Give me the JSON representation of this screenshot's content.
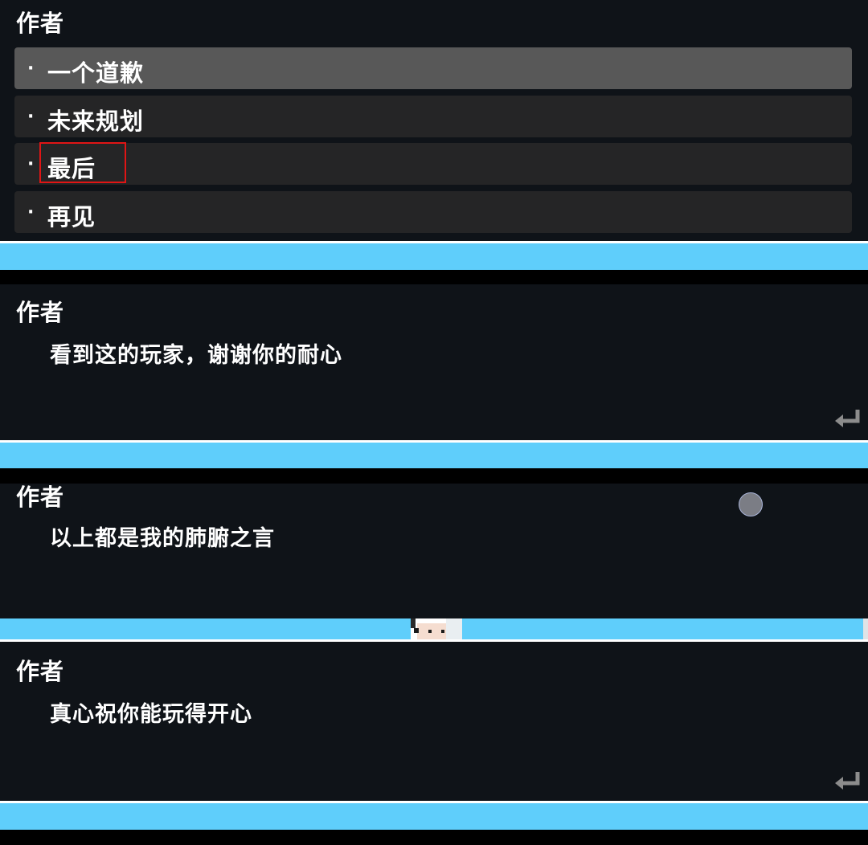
{
  "choice_menu": {
    "speaker": "作者",
    "options": [
      {
        "bullet": "·",
        "label": "一个道歉",
        "selected": true
      },
      {
        "bullet": "·",
        "label": "未来规划",
        "selected": false
      },
      {
        "bullet": "·",
        "label": "最后",
        "selected": false,
        "highlighted": true
      },
      {
        "bullet": "·",
        "label": "再见",
        "selected": false
      }
    ]
  },
  "dialogs": [
    {
      "speaker": "作者",
      "text": "看到这的玩家，谢谢你的耐心",
      "has_continue_icon": true
    },
    {
      "speaker": "作者",
      "text": "以上都是我的肺腑之言",
      "has_continue_icon": false
    },
    {
      "speaker": "作者",
      "text": "真心祝你能玩得开心",
      "has_continue_icon": true
    }
  ],
  "icons": {
    "continue": "return-arrow-icon",
    "auto": "circle-button-icon",
    "character": "pixel-character-icon"
  },
  "colors": {
    "panel_bg": "#0f1318",
    "option_bg": "#252526",
    "option_selected_bg": "#585858",
    "highlight": "#e01515",
    "sky": "#5fcefb"
  }
}
